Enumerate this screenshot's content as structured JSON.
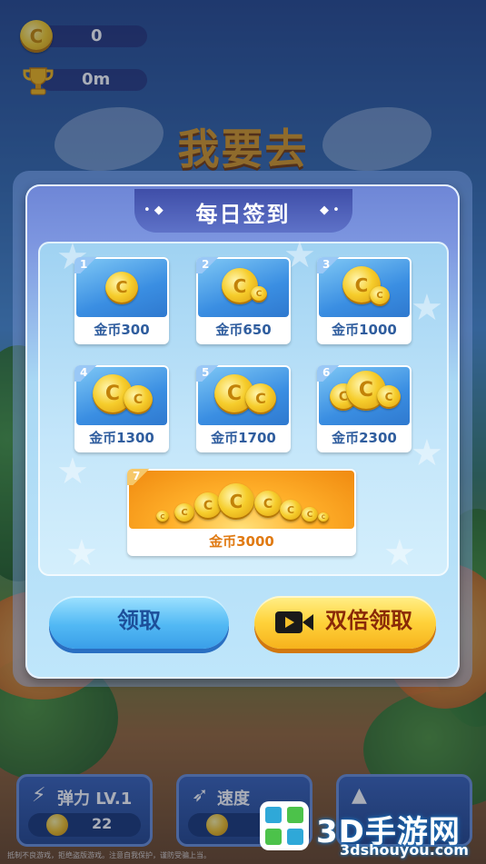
{
  "hud": {
    "coins": "0",
    "distance": "0m"
  },
  "background": {
    "title": "我要去"
  },
  "modal": {
    "title": "每日签到",
    "rewards": [
      {
        "day": "1",
        "label": "金币300"
      },
      {
        "day": "2",
        "label": "金币650"
      },
      {
        "day": "3",
        "label": "金币1000"
      },
      {
        "day": "4",
        "label": "金币1300"
      },
      {
        "day": "5",
        "label": "金币1700"
      },
      {
        "day": "6",
        "label": "金币2300"
      },
      {
        "day": "7",
        "label": "金币3000"
      }
    ],
    "claim_label": "领取",
    "double_claim_label": "双倍领取"
  },
  "upgrades": [
    {
      "label": "弹力",
      "level": "LV.1",
      "cost": "22"
    },
    {
      "label": "速度",
      "level": "",
      "cost": ""
    },
    {
      "label": "",
      "level": "",
      "cost": ""
    }
  ],
  "footer": {
    "notice": "抵制不良游戏，拒绝盗版游戏。注意自我保护，谨防受骗上当。"
  },
  "watermark": {
    "brand": "3D手游网",
    "url": "3dshouyou.com"
  },
  "colors": {
    "coin_gold": "#f6cd2c",
    "claim_blue": "#52b9f4",
    "double_gold": "#ffd23a",
    "title_bar": "#3f4ea8"
  }
}
